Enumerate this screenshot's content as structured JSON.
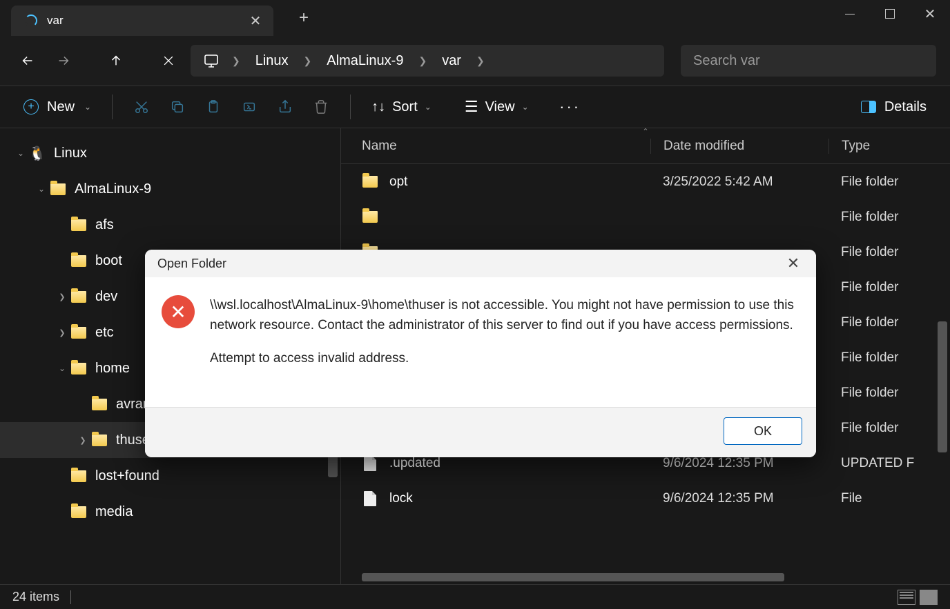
{
  "window": {
    "tab_title": "var"
  },
  "nav": {
    "breadcrumb": [
      "Linux",
      "AlmaLinux-9",
      "var"
    ],
    "search_placeholder": "Search var"
  },
  "toolbar": {
    "new_label": "New",
    "sort_label": "Sort",
    "view_label": "View",
    "details_label": "Details"
  },
  "tree": [
    {
      "depth": 0,
      "chev": "down",
      "icon": "penguin",
      "label": "Linux"
    },
    {
      "depth": 1,
      "chev": "down",
      "icon": "folder",
      "label": "AlmaLinux-9"
    },
    {
      "depth": 2,
      "chev": "",
      "icon": "folder",
      "label": "afs"
    },
    {
      "depth": 2,
      "chev": "",
      "icon": "folder",
      "label": "boot"
    },
    {
      "depth": 2,
      "chev": "right",
      "icon": "folder",
      "label": "dev"
    },
    {
      "depth": 2,
      "chev": "right",
      "icon": "folder",
      "label": "etc"
    },
    {
      "depth": 2,
      "chev": "down",
      "icon": "folder",
      "label": "home"
    },
    {
      "depth": 3,
      "chev": "",
      "icon": "folder",
      "label": "avram"
    },
    {
      "depth": 3,
      "chev": "right",
      "icon": "folder",
      "label": "thuser",
      "selected": true
    },
    {
      "depth": 2,
      "chev": "",
      "icon": "folder",
      "label": "lost+found"
    },
    {
      "depth": 2,
      "chev": "",
      "icon": "folder",
      "label": "media"
    }
  ],
  "list": {
    "headers": {
      "name": "Name",
      "date": "Date modified",
      "type": "Type"
    },
    "rows": [
      {
        "icon": "folder",
        "name": "opt",
        "date": "3/25/2022 5:42 AM",
        "type": "File folder"
      },
      {
        "icon": "folder",
        "name": "",
        "date": "",
        "type": "File folder"
      },
      {
        "icon": "folder",
        "name": "",
        "date": "",
        "type": "File folder"
      },
      {
        "icon": "folder",
        "name": "",
        "date": "",
        "type": "File folder"
      },
      {
        "icon": "folder",
        "name": "",
        "date": "",
        "type": "File folder"
      },
      {
        "icon": "folder",
        "name": "",
        "date": "",
        "type": "File folder"
      },
      {
        "icon": "folder",
        "name": "",
        "date": "",
        "type": "File folder"
      },
      {
        "icon": "folder",
        "name": "",
        "date": "",
        "type": "File folder"
      },
      {
        "icon": "file",
        "name": ".updated",
        "date": "9/6/2024 12:35 PM",
        "type": "UPDATED F"
      },
      {
        "icon": "file",
        "name": "lock",
        "date": "9/6/2024 12:35 PM",
        "type": "File"
      }
    ]
  },
  "status": {
    "item_count": "24 items"
  },
  "dialog": {
    "title": "Open Folder",
    "message1": "\\\\wsl.localhost\\AlmaLinux-9\\home\\thuser is not accessible. You might not have permission to use this network resource. Contact the administrator of this server to find out if you have access permissions.",
    "message2": "Attempt to access invalid address.",
    "ok_label": "OK"
  }
}
